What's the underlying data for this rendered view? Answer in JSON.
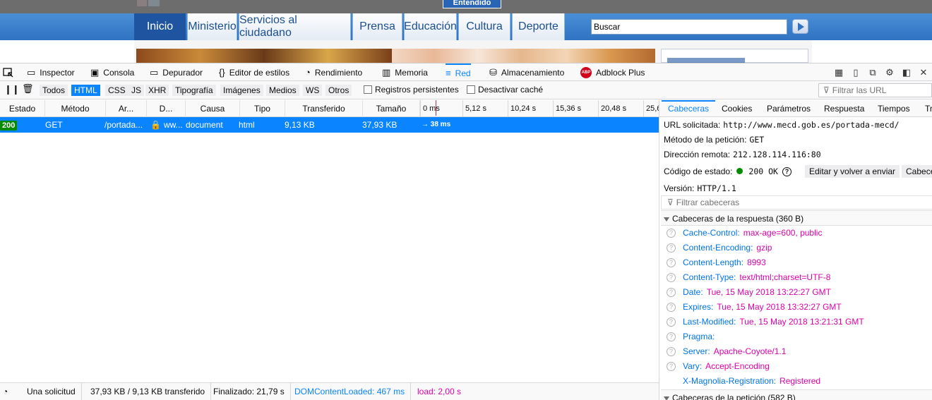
{
  "site": {
    "cookie_button": "Entendido",
    "nav": [
      "Inicio",
      "Ministerio",
      "Servicios al ciudadano",
      "Prensa",
      "Educación",
      "Cultura",
      "Deporte"
    ],
    "search_value": "Buscar"
  },
  "toolbox": {
    "tabs": [
      "Inspector",
      "Consola",
      "Depurador",
      "Editor de estilos",
      "Rendimiento",
      "Memoria",
      "Red",
      "Almacenamiento",
      "Adblock Plus"
    ],
    "selected_tab": "Red",
    "adblock_badge": "ABP"
  },
  "filters": {
    "types": [
      "Todos",
      "HTML",
      "CSS",
      "JS",
      "XHR",
      "Tipografía",
      "Imágenes",
      "Medios",
      "WS",
      "Otros"
    ],
    "active": "HTML",
    "persist_logs": "Registros persistentes",
    "disable_cache": "Desactivar caché",
    "url_filter_placeholder": "Filtrar las URL"
  },
  "request_columns": [
    "Estado",
    "Método",
    "Ar...",
    "D...",
    "Causa",
    "Tipo",
    "Transferido",
    "Tamaño"
  ],
  "waterfall_ticks": [
    "0 ms",
    "5,12 s",
    "10,24 s",
    "15,36 s",
    "20,48 s",
    "25,6"
  ],
  "request": {
    "status": "200",
    "method": "GET",
    "file": "/portada...",
    "domain": "ww...",
    "cause": "document",
    "type": "html",
    "transferred": "9,13 KB",
    "size": "37,93 KB",
    "timing": "→ 38 ms"
  },
  "status_bar": {
    "requests": "Una solicitud",
    "sizes": "37,93 KB / 9,13 KB transferido",
    "finished": "Finalizado: 21,79 s",
    "dom_loaded": "DOMContentLoaded: 467 ms",
    "load": "load: 2,00 s",
    "dom_color": "#0a84ff",
    "load_color": "#dd00a9"
  },
  "details": {
    "tabs": [
      "Cabeceras",
      "Cookies",
      "Parámetros",
      "Respuesta",
      "Tiempos",
      "Tr"
    ],
    "selected_tab": "Cabeceras",
    "url_label": "URL solicitada:",
    "url": "http://www.mecd.gob.es/portada-mecd/",
    "method_label": "Método de la petición:",
    "method": "GET",
    "remote_label": "Dirección remota:",
    "remote": "212.128.114.116:80",
    "status_label": "Código de estado:",
    "status": "200 OK",
    "edit_resend": "Editar y volver a enviar",
    "raw_headers": "Cabece",
    "version_label": "Versión:",
    "version": "HTTP/1.1",
    "header_filter_placeholder": "Filtrar cabeceras",
    "response_section": "Cabeceras de la respuesta (360 B)",
    "request_section": "Cabeceras de la petición (582 B)",
    "response_headers": [
      {
        "name": "Cache-Control:",
        "value": "max-age=600, public"
      },
      {
        "name": "Content-Encoding:",
        "value": "gzip"
      },
      {
        "name": "Content-Length:",
        "value": "8993"
      },
      {
        "name": "Content-Type:",
        "value": "text/html;charset=UTF-8"
      },
      {
        "name": "Date:",
        "value": "Tue, 15 May 2018 13:22:27 GMT"
      },
      {
        "name": "Expires:",
        "value": "Tue, 15 May 2018 13:32:27 GMT"
      },
      {
        "name": "Last-Modified:",
        "value": "Tue, 15 May 2018 13:21:31 GMT"
      },
      {
        "name": "Pragma:",
        "value": ""
      },
      {
        "name": "Server:",
        "value": "Apache-Coyote/1.1"
      },
      {
        "name": "Vary:",
        "value": "Accept-Encoding"
      },
      {
        "name": "X-Magnolia-Registration:",
        "value": "Registered"
      }
    ]
  }
}
